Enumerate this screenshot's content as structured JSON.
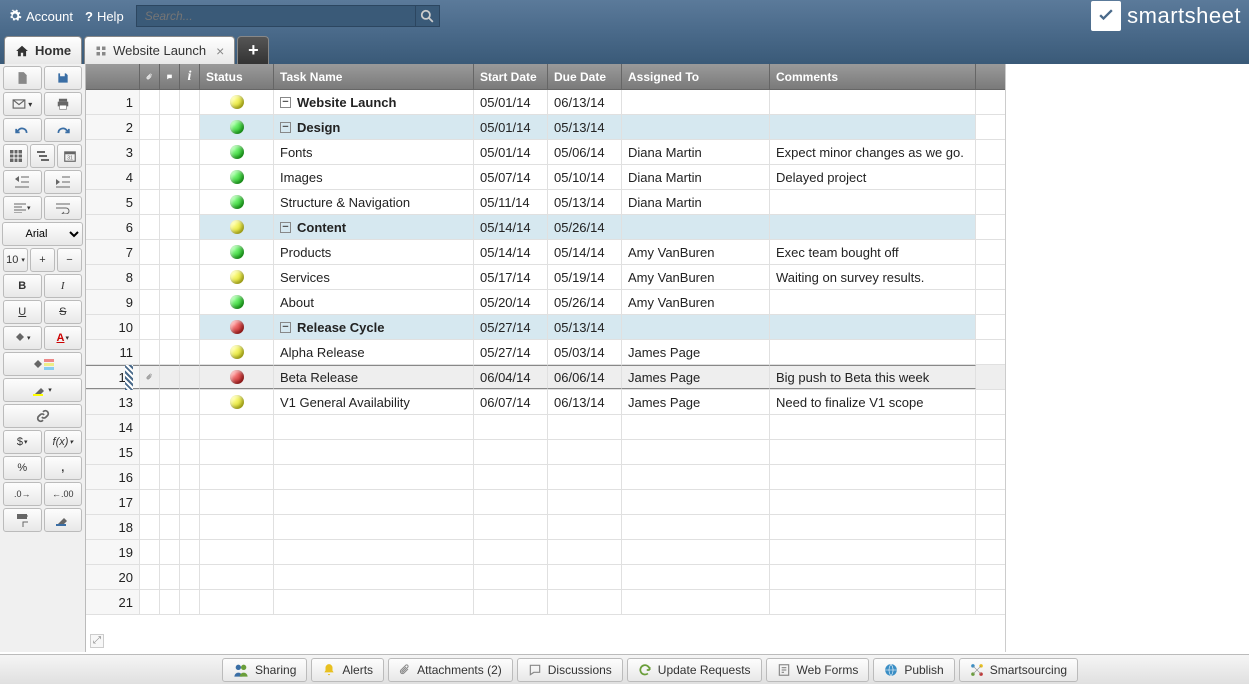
{
  "topbar": {
    "account_label": "Account",
    "help_label": "Help",
    "search_placeholder": "Search...",
    "brand": "smartsheet"
  },
  "tabs": {
    "home_label": "Home",
    "sheet_label": "Website Launch"
  },
  "toolbar": {
    "font_name": "Arial",
    "font_size": "10",
    "bold": "B",
    "italic": "I",
    "underline": "U",
    "strike": "S",
    "currency": "$",
    "fx": "f(x)",
    "percent": "%",
    "comma": ",",
    "dec_inc": ".0",
    "dec_dec": ".00"
  },
  "columns": {
    "status": "Status",
    "task": "Task Name",
    "start": "Start Date",
    "due": "Due Date",
    "assigned": "Assigned To",
    "comments": "Comments"
  },
  "rows": [
    {
      "n": "1",
      "status": "yellow",
      "indent": 0,
      "toggle": "−",
      "task": "Website Launch",
      "start": "05/01/14",
      "due": "06/13/14",
      "assigned": "",
      "comments": "",
      "hl": false,
      "bold": true
    },
    {
      "n": "2",
      "status": "green",
      "indent": 1,
      "toggle": "−",
      "task": "Design",
      "start": "05/01/14",
      "due": "05/13/14",
      "assigned": "",
      "comments": "",
      "hl": true,
      "bold": true
    },
    {
      "n": "3",
      "status": "green",
      "indent": 2,
      "toggle": "",
      "task": "Fonts",
      "start": "05/01/14",
      "due": "05/06/14",
      "assigned": "Diana Martin",
      "comments": "Expect minor changes as we go.",
      "hl": false
    },
    {
      "n": "4",
      "status": "green",
      "indent": 2,
      "toggle": "",
      "task": "Images",
      "start": "05/07/14",
      "due": "05/10/14",
      "assigned": "Diana Martin",
      "comments": "Delayed project",
      "hl": false
    },
    {
      "n": "5",
      "status": "green",
      "indent": 2,
      "toggle": "",
      "task": "Structure & Navigation",
      "start": "05/11/14",
      "due": "05/13/14",
      "assigned": "Diana Martin",
      "comments": "",
      "hl": false
    },
    {
      "n": "6",
      "status": "yellow",
      "indent": 1,
      "toggle": "−",
      "task": "Content",
      "start": "05/14/14",
      "due": "05/26/14",
      "assigned": "",
      "comments": "",
      "hl": true,
      "bold": true
    },
    {
      "n": "7",
      "status": "green",
      "indent": 2,
      "toggle": "",
      "task": "Products",
      "start": "05/14/14",
      "due": "05/14/14",
      "assigned": "Amy VanBuren",
      "comments": "Exec team bought off",
      "hl": false
    },
    {
      "n": "8",
      "status": "yellow",
      "indent": 2,
      "toggle": "",
      "task": "Services",
      "start": "05/17/14",
      "due": "05/19/14",
      "assigned": "Amy VanBuren",
      "comments": "Waiting on survey results.",
      "hl": false
    },
    {
      "n": "9",
      "status": "green",
      "indent": 2,
      "toggle": "",
      "task": "About",
      "start": "05/20/14",
      "due": "05/26/14",
      "assigned": "Amy VanBuren",
      "comments": "",
      "hl": false
    },
    {
      "n": "10",
      "status": "red",
      "indent": 1,
      "toggle": "−",
      "task": "Release Cycle",
      "start": "05/27/14",
      "due": "05/13/14",
      "assigned": "",
      "comments": "",
      "hl": true,
      "bold": true
    },
    {
      "n": "11",
      "status": "yellow",
      "indent": 2,
      "toggle": "",
      "task": "Alpha Release",
      "start": "05/27/14",
      "due": "05/03/14",
      "assigned": "James Page",
      "comments": "",
      "hl": false
    },
    {
      "n": "12",
      "status": "red",
      "indent": 2,
      "toggle": "",
      "task": "Beta Release",
      "start": "06/04/14",
      "due": "06/06/14",
      "assigned": "James Page",
      "comments": "Big push to Beta this week",
      "hl": false,
      "selected": true,
      "attach": true
    },
    {
      "n": "13",
      "status": "yellow",
      "indent": 2,
      "toggle": "",
      "task": "V1 General Availability",
      "start": "06/07/14",
      "due": "06/13/14",
      "assigned": "James Page",
      "comments": "Need to finalize V1 scope",
      "hl": false
    },
    {
      "n": "14"
    },
    {
      "n": "15"
    },
    {
      "n": "16"
    },
    {
      "n": "17"
    },
    {
      "n": "18"
    },
    {
      "n": "19"
    },
    {
      "n": "20"
    },
    {
      "n": "21"
    }
  ],
  "bottom": {
    "sharing": "Sharing",
    "alerts": "Alerts",
    "attachments": "Attachments  (2)",
    "discussions": "Discussions",
    "update_requests": "Update Requests",
    "web_forms": "Web Forms",
    "publish": "Publish",
    "smartsourcing": "Smartsourcing"
  }
}
